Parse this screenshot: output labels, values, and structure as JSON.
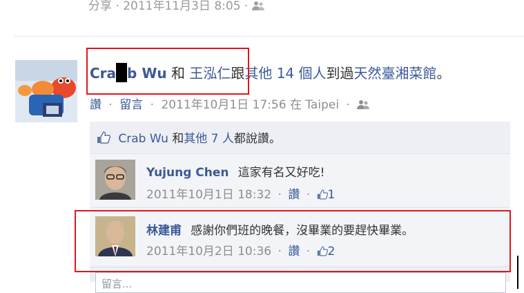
{
  "top_row": {
    "share_label": "分享",
    "timestamp": "2011年11月3日 8:05"
  },
  "story": {
    "actor_name_start": "Cra",
    "actor_name_end": "b Wu",
    "connector": "和",
    "tagged_friend": "王泓仁",
    "with": "跟",
    "others_link": "其他 14 個人",
    "action": "到過",
    "place": "天然臺湘菜館",
    "end_punct": "。",
    "meta": {
      "like_label": "讚",
      "comment_label": "留言",
      "timestamp": "2011年10月1日 17:56",
      "location_prefix": "在",
      "location": "Taipei"
    }
  },
  "likes_summary": {
    "name": "Crab Wu",
    "and": "和",
    "others": "其他 7 人",
    "suffix": "都說讚。"
  },
  "comments": [
    {
      "author": "Yujung Chen",
      "text": "這家有名又好吃!",
      "timestamp": "2011年10月1日 18:32",
      "like_label": "讚",
      "like_count": "1"
    },
    {
      "author": "林建甫",
      "text": "感謝你們班的晚餐，沒畢業的要趕快畢業。",
      "timestamp": "2011年10月2日 10:36",
      "like_label": "讚",
      "like_count": "2"
    }
  ],
  "comment_input": {
    "placeholder": "留言..."
  },
  "colors": {
    "link_blue": "#3b5998",
    "meta_grey": "#8e8e8e",
    "feedback_bg": "#edeff4",
    "annotation_red": "#e0161b"
  }
}
